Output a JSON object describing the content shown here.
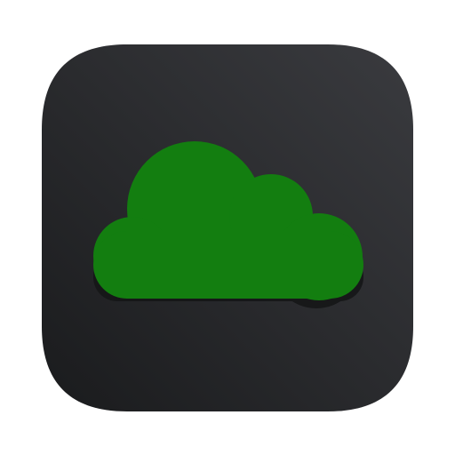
{
  "icon": {
    "name": "cloud-app-icon",
    "glyph": "cloud-icon",
    "colors": {
      "tile_top": "#3a3b3f",
      "tile_bottom": "#1a1b1d",
      "cloud_fill": "#137e10",
      "cloud_shadow": "#141516"
    }
  }
}
